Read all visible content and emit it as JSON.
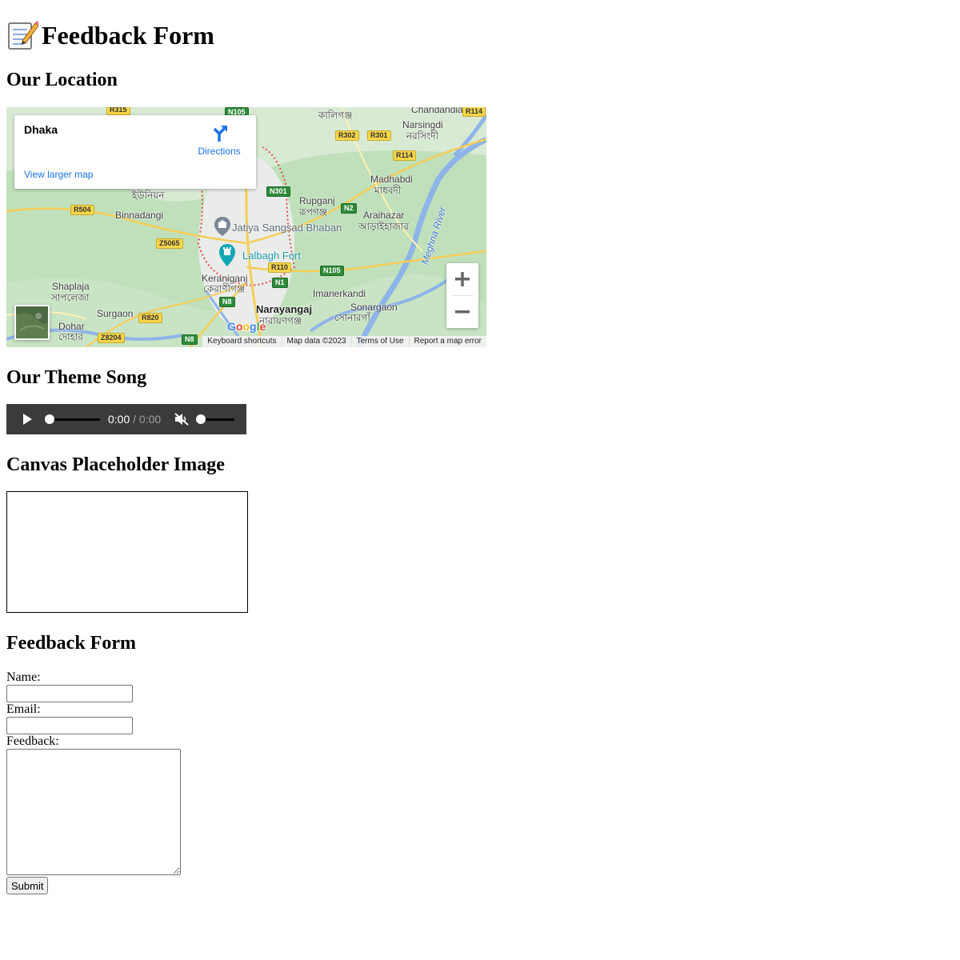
{
  "header": {
    "title": "Feedback Form",
    "icon": "memo-icon"
  },
  "location": {
    "heading": "Our Location",
    "map": {
      "place_name": "Dhaka",
      "directions_label": "Directions",
      "larger_map_label": "View larger map",
      "labels": {
        "rupganj": "Rupganj",
        "rupganj_bn": "রূপগঞ্জ",
        "narsingdi": "Narsingdi",
        "narsingdi_bn": "নরসিংদী",
        "madhabdi": "Madhabdi",
        "madhabdi_bn": "মাধবদী",
        "araihazar": "Araihazar",
        "araihazar_bn": "আড়াইহাজার",
        "binnadangi": "Binnadangi",
        "union_bn": "ইউনিয়ন",
        "jatiya": "Jatiya Sangsad Bhaban",
        "lalbagh": "Lalbagh Fort",
        "keraniganj": "Keraniganj",
        "keraniganj_bn": "কেরাণীগঞ্জ",
        "imanerkandi": "Imanerkandi",
        "shaplaja": "Shaplaja",
        "shaplaja_bn": "সাপলেজা",
        "surgaon": "Surgaon",
        "narayanganj": "Narayangaj",
        "narayanganj_bn": "নারায়ণগঞ্জ",
        "sonargaon": "Sonargaon",
        "sonargaon_bn": "সোনারগাঁ",
        "dohar": "Dohar",
        "dohar_bn": "দোহার",
        "chandandia": "Chandandia",
        "kaliganj_bn": "কালিগঞ্জ",
        "meghna": "Meghna River"
      },
      "shields": {
        "r315": "R315",
        "n105a": "N105",
        "r302": "R302",
        "r301": "R301",
        "r114a": "R114",
        "r114b": "R114",
        "n301": "N301",
        "n2": "N2",
        "r504": "R504",
        "z5065": "Z5065",
        "r110": "R110",
        "n105b": "N105",
        "n1": "N1",
        "n8a": "N8",
        "r820": "R820",
        "z8204": "Z8204",
        "n8b": "N8"
      },
      "google_logo": "Google",
      "attribution": {
        "shortcuts": "Keyboard shortcuts",
        "map_data": "Map data ©2023",
        "terms": "Terms of Use",
        "report": "Report a map error"
      },
      "icons": [
        "directions-icon",
        "zoom-in-icon",
        "zoom-out-icon",
        "satellite-thumbnail",
        "museum-pin-icon",
        "fort-pin-icon"
      ]
    }
  },
  "song": {
    "heading": "Our Theme Song",
    "player": {
      "current_time": "0:00",
      "duration": "/ 0:00",
      "progress": 0,
      "volume": 0,
      "muted": true
    }
  },
  "canvas": {
    "heading": "Canvas Placeholder Image"
  },
  "form": {
    "heading": "Feedback Form",
    "name_label": "Name:",
    "name_value": "",
    "email_label": "Email:",
    "email_value": "",
    "feedback_label": "Feedback:",
    "feedback_value": "",
    "submit_label": "Submit"
  },
  "colors": {
    "map_green": "#b9dcb6",
    "link_blue": "#1a73e8",
    "player_bg": "#3b3b3b",
    "poi_teal": "#1a9aa8",
    "river_blue": "#3b73c9"
  }
}
